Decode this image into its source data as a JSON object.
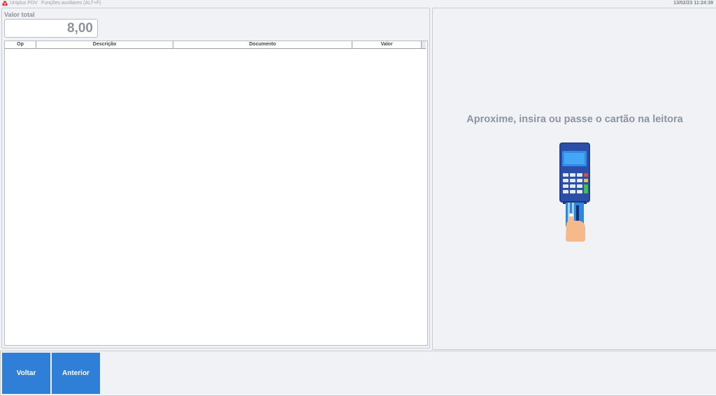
{
  "titlebar": {
    "app_name": "Uniplus PDV",
    "menu_label": "Funções auxiliares (ALT+F)",
    "datetime": "13/02/23 11:24:39",
    "logo_icon": "uniplus-logo-icon"
  },
  "summary": {
    "total_label": "Valor total",
    "total_value": "8,00"
  },
  "table": {
    "columns": [
      "Op",
      "Descrição",
      "Documento",
      "Valor"
    ],
    "rows": []
  },
  "payment": {
    "prompt": "Aproxime, insira ou passe o cartão na leitora",
    "illustration_icon": "card-terminal-icon"
  },
  "actions": {
    "back_label": "Voltar",
    "previous_label": "Anterior"
  },
  "colors": {
    "button_blue": "#2f7fd8",
    "background": "#f0f2f6",
    "muted_text": "#8c959e"
  }
}
